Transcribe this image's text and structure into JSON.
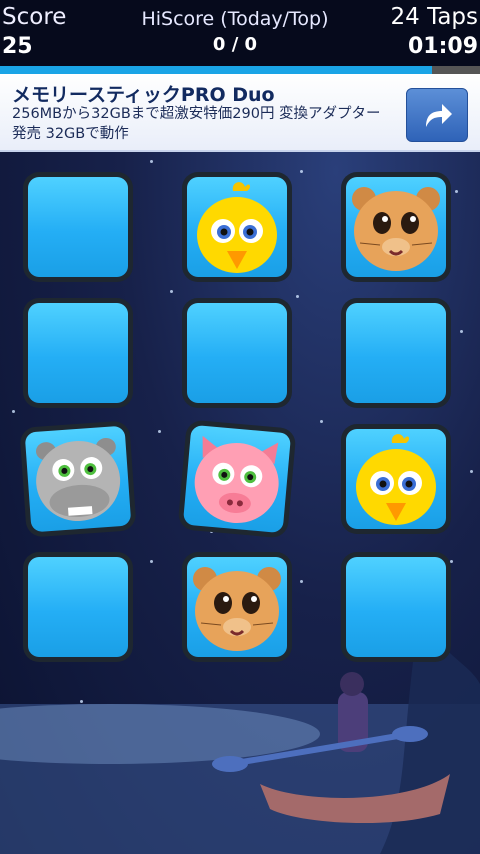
{
  "hud": {
    "score_label": "Score",
    "score_value": "25",
    "hiscore_label": "HiScore (Today/Top)",
    "hiscore_value": "0 / 0",
    "taps": "24 Taps",
    "timer": "01:09",
    "progress_fraction": 0.9
  },
  "ad": {
    "title": "メモリースティックPRO Duo",
    "body": "256MBから32GBまで超激安特価290円 変換アダプター発売 32GBで動作",
    "button_icon": "share-arrow-icon"
  },
  "cards": [
    {
      "state": "face-down"
    },
    {
      "state": "face-up",
      "animal": "chick"
    },
    {
      "state": "face-up",
      "animal": "hamster"
    },
    {
      "state": "face-down"
    },
    {
      "state": "face-down"
    },
    {
      "state": "face-down"
    },
    {
      "state": "face-up",
      "animal": "hippo"
    },
    {
      "state": "face-up",
      "animal": "pig"
    },
    {
      "state": "face-up",
      "animal": "chick"
    },
    {
      "state": "face-down"
    },
    {
      "state": "face-up",
      "animal": "hamster"
    },
    {
      "state": "face-down"
    }
  ],
  "colors": {
    "card_face": "#24aef5",
    "progress": "#1aa4e6",
    "hud_bg": "#060a1c"
  }
}
